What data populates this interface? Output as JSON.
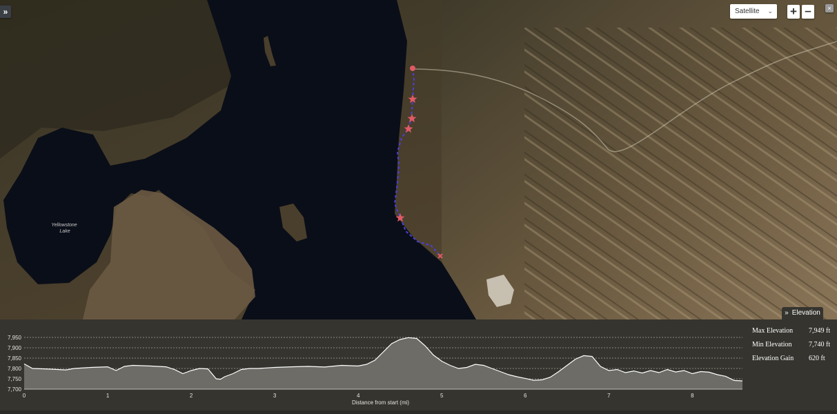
{
  "map": {
    "lake_label": [
      "Yellowstone",
      "Lake"
    ],
    "basemap": "satellite",
    "route_color": "#4b3fd6",
    "poi_color": "#e05a66"
  },
  "controls": {
    "collapse_icon": "double-chevron-right-icon",
    "collapse_label": "»",
    "layer_select_value": "Satellite",
    "zoom_in_label": "+",
    "zoom_out_label": "–",
    "close_label": "×"
  },
  "elevation_tab": {
    "label": "Elevation",
    "icon": "double-chevron-down-icon"
  },
  "stats": {
    "max_label": "Max Elevation",
    "max_value": "7,949 ft",
    "min_label": "Min Elevation",
    "min_value": "7,740 ft",
    "gain_label": "Elevation Gain",
    "gain_value": "620 ft"
  },
  "chart_data": {
    "type": "area",
    "xlabel": "Distance from start (mi)",
    "ylabel": "",
    "xlim": [
      0,
      8.6
    ],
    "ylim": [
      7700,
      7950
    ],
    "x_ticks": [
      0,
      1,
      2,
      3,
      4,
      5,
      6,
      7,
      8
    ],
    "y_ticks": [
      7700,
      7750,
      7800,
      7850,
      7900,
      7950
    ],
    "y_tick_labels": [
      "7,700",
      "7,750",
      "7,800",
      "7,850",
      "7,900",
      "7,950"
    ],
    "grid": "horizontal dashed",
    "x": [
      0,
      0.1,
      0.3,
      0.5,
      0.6,
      0.8,
      1.0,
      1.1,
      1.2,
      1.3,
      1.5,
      1.7,
      1.8,
      1.9,
      2.0,
      2.1,
      2.2,
      2.3,
      2.35,
      2.4,
      2.5,
      2.6,
      2.7,
      2.8,
      3.0,
      3.2,
      3.4,
      3.6,
      3.8,
      4.0,
      4.1,
      4.2,
      4.3,
      4.4,
      4.5,
      4.6,
      4.7,
      4.8,
      4.9,
      5.0,
      5.1,
      5.2,
      5.3,
      5.4,
      5.5,
      5.6,
      5.7,
      5.8,
      5.9,
      6.0,
      6.1,
      6.2,
      6.3,
      6.4,
      6.5,
      6.6,
      6.7,
      6.8,
      6.9,
      7.0,
      7.1,
      7.2,
      7.3,
      7.4,
      7.5,
      7.6,
      7.7,
      7.8,
      7.9,
      8.0,
      8.1,
      8.2,
      8.3,
      8.4,
      8.5,
      8.6
    ],
    "values": [
      7822,
      7800,
      7797,
      7793,
      7800,
      7805,
      7808,
      7790,
      7810,
      7815,
      7812,
      7808,
      7795,
      7775,
      7790,
      7800,
      7798,
      7750,
      7748,
      7760,
      7775,
      7795,
      7800,
      7800,
      7805,
      7808,
      7810,
      7807,
      7815,
      7812,
      7820,
      7840,
      7880,
      7920,
      7940,
      7949,
      7945,
      7910,
      7865,
      7835,
      7815,
      7800,
      7805,
      7820,
      7815,
      7800,
      7785,
      7770,
      7760,
      7752,
      7743,
      7745,
      7758,
      7785,
      7815,
      7845,
      7862,
      7858,
      7810,
      7790,
      7795,
      7780,
      7788,
      7778,
      7790,
      7780,
      7795,
      7783,
      7790,
      7775,
      7785,
      7782,
      7770,
      7762,
      7742,
      7740
    ]
  }
}
